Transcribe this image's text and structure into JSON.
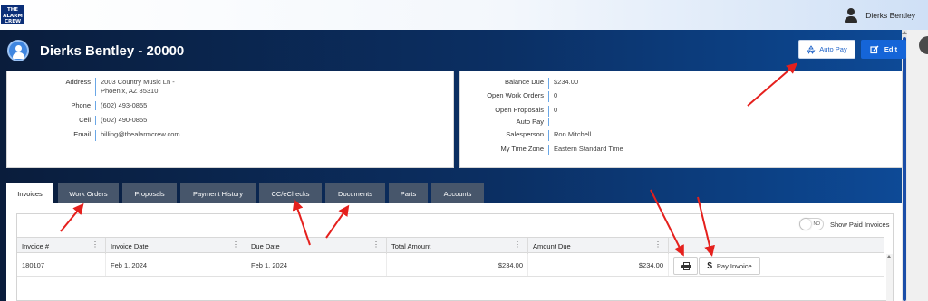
{
  "topbar": {
    "logo_lines": [
      "THE",
      "ALARM",
      "CREW"
    ],
    "user_name": "Dierks Bentley"
  },
  "header": {
    "title": "Dierks Bentley - 20000",
    "autopay_label": "Auto Pay",
    "edit_label": "Edit"
  },
  "contact": {
    "address_label": "Address",
    "address_line1": "2003 Country Music Ln -",
    "address_line2": "Phoenix, AZ 85310",
    "phone_label": "Phone",
    "phone": "(602) 493-0855",
    "cell_label": "Cell",
    "cell": "(602) 490-0855",
    "email_label": "Email",
    "email": "billing@thealarmcrew.com"
  },
  "account": {
    "balance_label": "Balance Due",
    "balance": "$234.00",
    "open_wo_label": "Open Work Orders",
    "open_wo": "0",
    "open_prop_label": "Open Proposals",
    "open_prop": "0",
    "autopay_label": "Auto Pay",
    "autopay": "",
    "salesperson_label": "Salesperson",
    "salesperson": "Ron Mitchell",
    "timezone_label": "My Time Zone",
    "timezone": "Eastern Standard Time"
  },
  "tabs": [
    "Invoices",
    "Work Orders",
    "Proposals",
    "Payment History",
    "CC/eChecks",
    "Documents",
    "Parts",
    "Accounts"
  ],
  "invoices": {
    "toggle_text": "NO",
    "show_paid_label": "Show Paid Invoices",
    "columns": [
      "Invoice #",
      "Invoice Date",
      "Due Date",
      "Total Amount",
      "Amount Due"
    ],
    "rows": [
      {
        "invoice": "180107",
        "invoice_date": "Feb 1, 2024",
        "due_date": "Feb 1, 2024",
        "total": "$234.00",
        "due": "$234.00"
      }
    ],
    "pay_label": "Pay Invoice"
  },
  "colors": {
    "accent": "#1565d8",
    "annotation": "#e5201d"
  },
  "icons": [
    "user-icon",
    "avatar-icon",
    "recycle-icon",
    "edit-icon",
    "printer-icon",
    "dollar-icon",
    "kebab-icon"
  ]
}
